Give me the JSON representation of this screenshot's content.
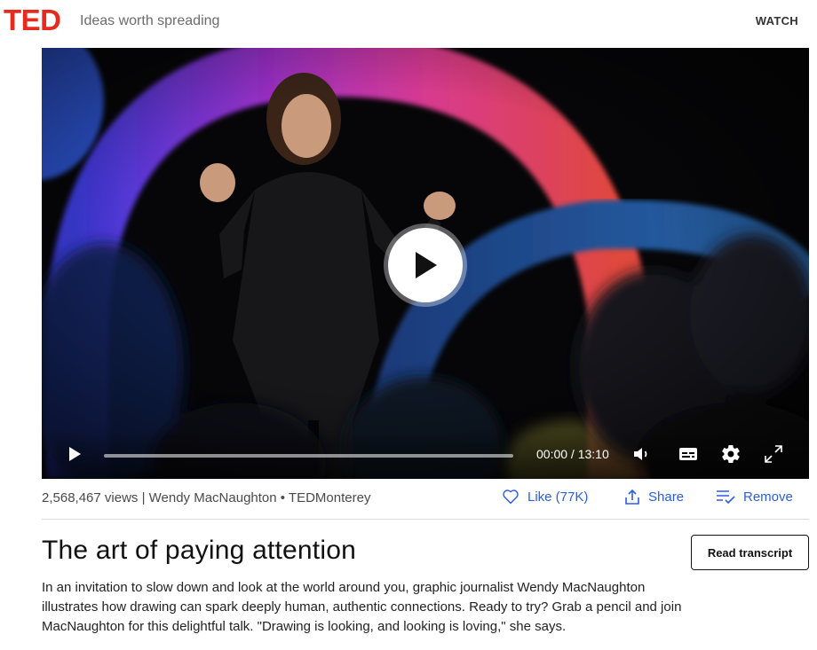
{
  "header": {
    "logo": "TED",
    "tagline": "Ideas worth spreading",
    "nav_watch": "WATCH"
  },
  "player": {
    "time": "00:00 / 13:10",
    "progress": 0,
    "icons": [
      "play-icon",
      "volume-icon",
      "captions-icon",
      "settings-gear-icon",
      "fullscreen-icon"
    ]
  },
  "meta": {
    "views": "2,568,467 views",
    "speaker": "Wendy MacNaughton",
    "event": "TEDMonterey",
    "text": "2,568,467 views | Wendy MacNaughton • TEDMonterey"
  },
  "actions": {
    "like": "Like (77K)",
    "share": "Share",
    "remove": "Remove"
  },
  "talk": {
    "title": "The art of paying attention",
    "read_transcript": "Read transcript",
    "description": "In an invitation to slow down and look at the world around you, graphic journalist Wendy MacNaughton illustrates how drawing can spark deeply human, authentic connections. Ready to try? Grab a pencil and join MacNaughton for this delightful talk. \"Drawing is looking, and looking is loving,\" she says."
  },
  "colors": {
    "brand": "#e62b1e",
    "link": "#2a5ce6"
  }
}
